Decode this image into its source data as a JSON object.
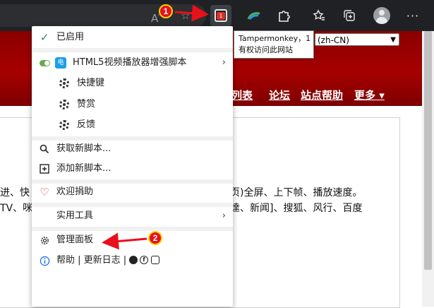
{
  "toolbar": {
    "icons": [
      "font-size-icon",
      "star-add-icon",
      "tampermonkey-icon",
      "extension-icon",
      "puzzle-icon",
      "favorites-icon",
      "collections-icon",
      "profile-avatar",
      "more-icon"
    ],
    "tampermonkey_badge": "1"
  },
  "tooltip": {
    "line1": "Tampermonkey，1",
    "line2": "有权访问此网站"
  },
  "page": {
    "language_select": "(zh-CN)",
    "nav": [
      "列表",
      "论坛",
      "站点帮助",
      "更多 ▾"
    ],
    "body_line1_left": "进、快",
    "body_line1_right": "页)全屏、上下帧、播放速度。",
    "body_line2_left": "TV、咪",
    "body_line2_right": "達、新闻]、搜狐、风行、百度"
  },
  "menu": {
    "enabled_label": "已启用",
    "script_name": "HTML5视频播放器增强脚本",
    "script_icon_text": "电",
    "submenu": [
      "快捷键",
      "赞赏",
      "反馈"
    ],
    "get_scripts": "获取新脚本...",
    "add_script": "添加新脚本...",
    "donate": "欢迎捐助",
    "utilities": "实用工具",
    "dashboard": "管理面板",
    "help_line": "帮助 | 更新日志 |"
  },
  "annotations": {
    "marker1": "1",
    "marker2": "2",
    "color": "#e8101a"
  },
  "colors": {
    "banner": "#a60000",
    "toolbar": "#202124",
    "check": "#2e8b57",
    "heart": "#d93025"
  }
}
